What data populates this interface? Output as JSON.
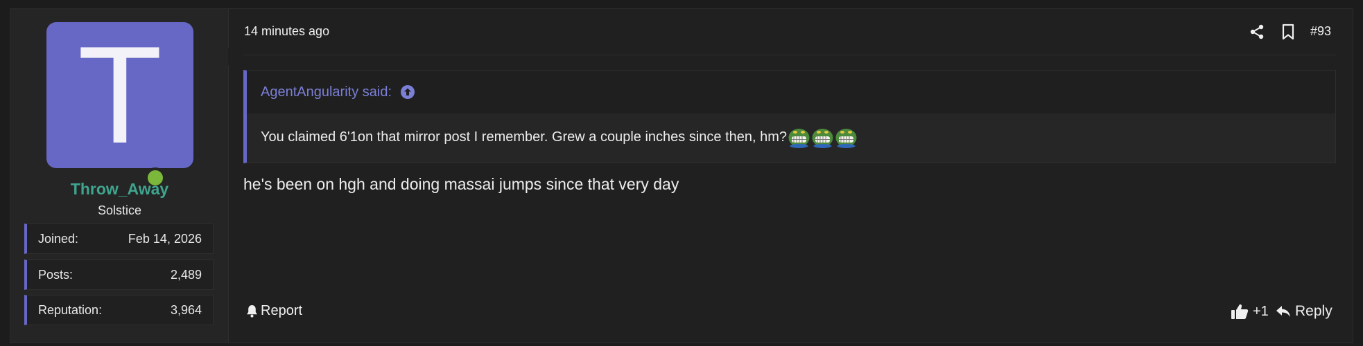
{
  "user": {
    "avatar_letter": "T",
    "avatar_color": "#6767c5",
    "online_color": "#7ab73a",
    "username": "Throw_Away",
    "username_color": "#3fa58e",
    "title": "Solstice",
    "stats": [
      {
        "label": "Joined:",
        "value": "Feb 14, 2026"
      },
      {
        "label": "Posts:",
        "value": "2,489"
      },
      {
        "label": "Reputation:",
        "value": "3,964"
      }
    ]
  },
  "post": {
    "timestamp": "14 minutes ago",
    "number": "#93",
    "share_icon": "share-icon",
    "bookmark_icon": "bookmark-icon",
    "quote": {
      "author_said": "AgentAngularity said:",
      "text": "You claimed 6'1on that mirror post I remember. Grew a couple inches since then, hm?",
      "emoji": [
        "grinning-goblin-emoji",
        "grinning-goblin-emoji",
        "grinning-goblin-emoji"
      ]
    },
    "message": "he's been on hgh and doing massai jumps since that very day"
  },
  "actions": {
    "report": "Report",
    "like_count": "+1",
    "reply": "Reply"
  },
  "colors": {
    "accent": "#6767c5",
    "background": "#202020"
  }
}
